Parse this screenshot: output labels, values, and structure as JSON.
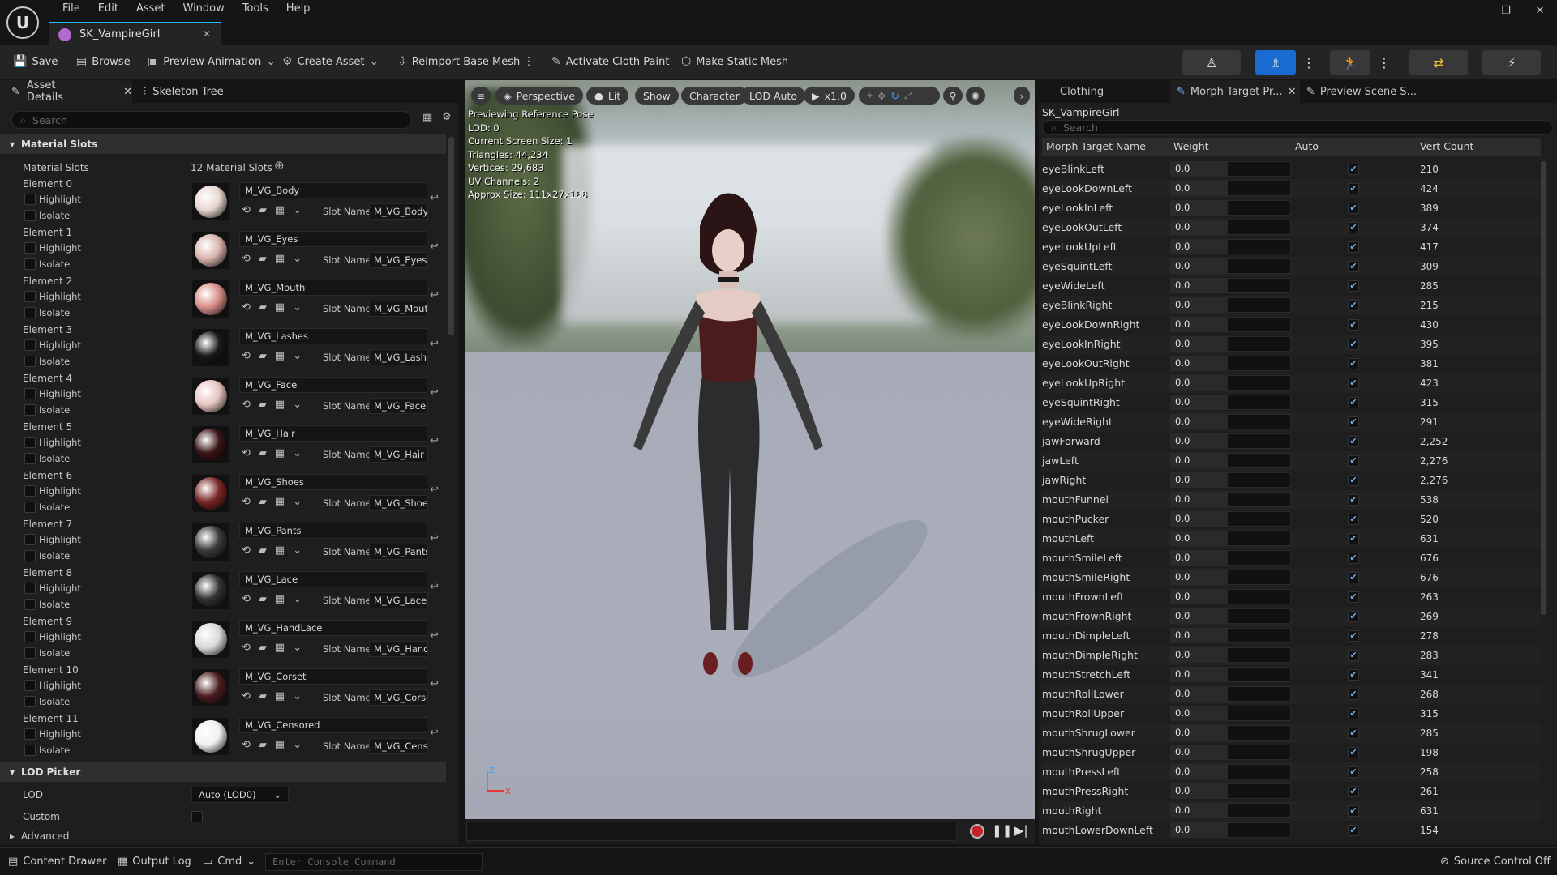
{
  "app": {
    "logo": "U",
    "menu": [
      "File",
      "Edit",
      "Asset",
      "Window",
      "Tools",
      "Help"
    ],
    "doc_tab": "SK_VampireGirl",
    "window_controls": [
      "—",
      "❐",
      "✕"
    ]
  },
  "toolbar": {
    "save": "Save",
    "browse": "Browse",
    "preview_animation": "Preview Animation",
    "create_asset": "Create Asset",
    "reimport": "Reimport Base Mesh",
    "cloth_paint": "Activate Cloth Paint",
    "static_mesh": "Make Static Mesh"
  },
  "left": {
    "tabs": [
      "Asset Details",
      "Skeleton Tree"
    ],
    "search_placeholder": "Search",
    "section_material": "Material Slots",
    "material_slots_label": "Material Slots",
    "material_slots_count": "12 Material Slots",
    "highlight": "Highlight",
    "isolate": "Isolate",
    "slot_name": "Slot Name",
    "elements": [
      {
        "label": "Element 0",
        "material": "M_VG_Body",
        "slot": "M_VG_Body",
        "color": "#e8d6d0"
      },
      {
        "label": "Element 1",
        "material": "M_VG_Eyes",
        "slot": "M_VG_Eyes",
        "color": "#d9b3ad"
      },
      {
        "label": "Element 2",
        "material": "M_VG_Mouth",
        "slot": "M_VG_Mouth",
        "color": "#d98d88"
      },
      {
        "label": "Element 3",
        "material": "M_VG_Lashes",
        "slot": "M_VG_Lashes",
        "color": "#1a1a1a"
      },
      {
        "label": "Element 4",
        "material": "M_VG_Face",
        "slot": "M_VG_Face",
        "color": "#e6c5bf"
      },
      {
        "label": "Element 5",
        "material": "M_VG_Hair",
        "slot": "M_VG_Hair",
        "color": "#3a1416"
      },
      {
        "label": "Element 6",
        "material": "M_VG_Shoes",
        "slot": "M_VG_Shoes",
        "color": "#7a2626"
      },
      {
        "label": "Element 7",
        "material": "M_VG_Pants",
        "slot": "M_VG_Pants",
        "color": "#3b3b3b"
      },
      {
        "label": "Element 8",
        "material": "M_VG_Lace",
        "slot": "M_VG_Lace",
        "color": "#333333"
      },
      {
        "label": "Element 9",
        "material": "M_VG_HandLace",
        "slot": "M_VG_HandLace",
        "color": "#d9d9d9"
      },
      {
        "label": "Element 10",
        "material": "M_VG_Corset",
        "slot": "M_VG_Corset",
        "color": "#4a1e20"
      },
      {
        "label": "Element 11",
        "material": "M_VG_Censored",
        "slot": "M_VG_Censored",
        "color": "#f0f0f0"
      }
    ],
    "section_lod": "LOD Picker",
    "lod_label": "LOD",
    "lod_value": "Auto (LOD0)",
    "custom_label": "Custom",
    "advanced": "Advanced"
  },
  "viewport": {
    "buttons": [
      "Perspective",
      "Lit",
      "Show",
      "Character",
      "LOD Auto",
      "x1.0"
    ],
    "info": [
      "Previewing Reference Pose",
      "LOD: 0",
      "Current Screen Size: 1",
      "Triangles: 44,234",
      "Vertices: 29,683",
      "UV Channels: 2",
      "Approx Size: 111x27x188"
    ],
    "axis_z": "Z",
    "axis_x": "X"
  },
  "right": {
    "tabs": [
      "Clothing",
      "Morph Target Pr...",
      "Preview Scene S..."
    ],
    "asset_name": "SK_VampireGirl",
    "search_placeholder": "Search",
    "columns": [
      "Morph Target Name",
      "Weight",
      "Auto",
      "Vert Count"
    ],
    "morphs": [
      {
        "name": "eyeBlinkLeft",
        "weight": "0.0",
        "count": "210"
      },
      {
        "name": "eyeLookDownLeft",
        "weight": "0.0",
        "count": "424"
      },
      {
        "name": "eyeLookInLeft",
        "weight": "0.0",
        "count": "389"
      },
      {
        "name": "eyeLookOutLeft",
        "weight": "0.0",
        "count": "374"
      },
      {
        "name": "eyeLookUpLeft",
        "weight": "0.0",
        "count": "417"
      },
      {
        "name": "eyeSquintLeft",
        "weight": "0.0",
        "count": "309"
      },
      {
        "name": "eyeWideLeft",
        "weight": "0.0",
        "count": "285"
      },
      {
        "name": "eyeBlinkRight",
        "weight": "0.0",
        "count": "215"
      },
      {
        "name": "eyeLookDownRight",
        "weight": "0.0",
        "count": "430"
      },
      {
        "name": "eyeLookInRight",
        "weight": "0.0",
        "count": "395"
      },
      {
        "name": "eyeLookOutRight",
        "weight": "0.0",
        "count": "381"
      },
      {
        "name": "eyeLookUpRight",
        "weight": "0.0",
        "count": "423"
      },
      {
        "name": "eyeSquintRight",
        "weight": "0.0",
        "count": "315"
      },
      {
        "name": "eyeWideRight",
        "weight": "0.0",
        "count": "291"
      },
      {
        "name": "jawForward",
        "weight": "0.0",
        "count": "2,252"
      },
      {
        "name": "jawLeft",
        "weight": "0.0",
        "count": "2,276"
      },
      {
        "name": "jawRight",
        "weight": "0.0",
        "count": "2,276"
      },
      {
        "name": "mouthFunnel",
        "weight": "0.0",
        "count": "538"
      },
      {
        "name": "mouthPucker",
        "weight": "0.0",
        "count": "520"
      },
      {
        "name": "mouthLeft",
        "weight": "0.0",
        "count": "631"
      },
      {
        "name": "mouthSmileLeft",
        "weight": "0.0",
        "count": "676"
      },
      {
        "name": "mouthSmileRight",
        "weight": "0.0",
        "count": "676"
      },
      {
        "name": "mouthFrownLeft",
        "weight": "0.0",
        "count": "263"
      },
      {
        "name": "mouthFrownRight",
        "weight": "0.0",
        "count": "269"
      },
      {
        "name": "mouthDimpleLeft",
        "weight": "0.0",
        "count": "278"
      },
      {
        "name": "mouthDimpleRight",
        "weight": "0.0",
        "count": "283"
      },
      {
        "name": "mouthStretchLeft",
        "weight": "0.0",
        "count": "341"
      },
      {
        "name": "mouthRollLower",
        "weight": "0.0",
        "count": "268"
      },
      {
        "name": "mouthRollUpper",
        "weight": "0.0",
        "count": "315"
      },
      {
        "name": "mouthShrugLower",
        "weight": "0.0",
        "count": "285"
      },
      {
        "name": "mouthShrugUpper",
        "weight": "0.0",
        "count": "198"
      },
      {
        "name": "mouthPressLeft",
        "weight": "0.0",
        "count": "258"
      },
      {
        "name": "mouthPressRight",
        "weight": "0.0",
        "count": "261"
      },
      {
        "name": "mouthRight",
        "weight": "0.0",
        "count": "631"
      },
      {
        "name": "mouthLowerDownLeft",
        "weight": "0.0",
        "count": "154"
      }
    ]
  },
  "status": {
    "content_drawer": "Content Drawer",
    "output_log": "Output Log",
    "cmd": "Cmd",
    "console_placeholder": "Enter Console Command",
    "source_control": "Source Control Off"
  }
}
